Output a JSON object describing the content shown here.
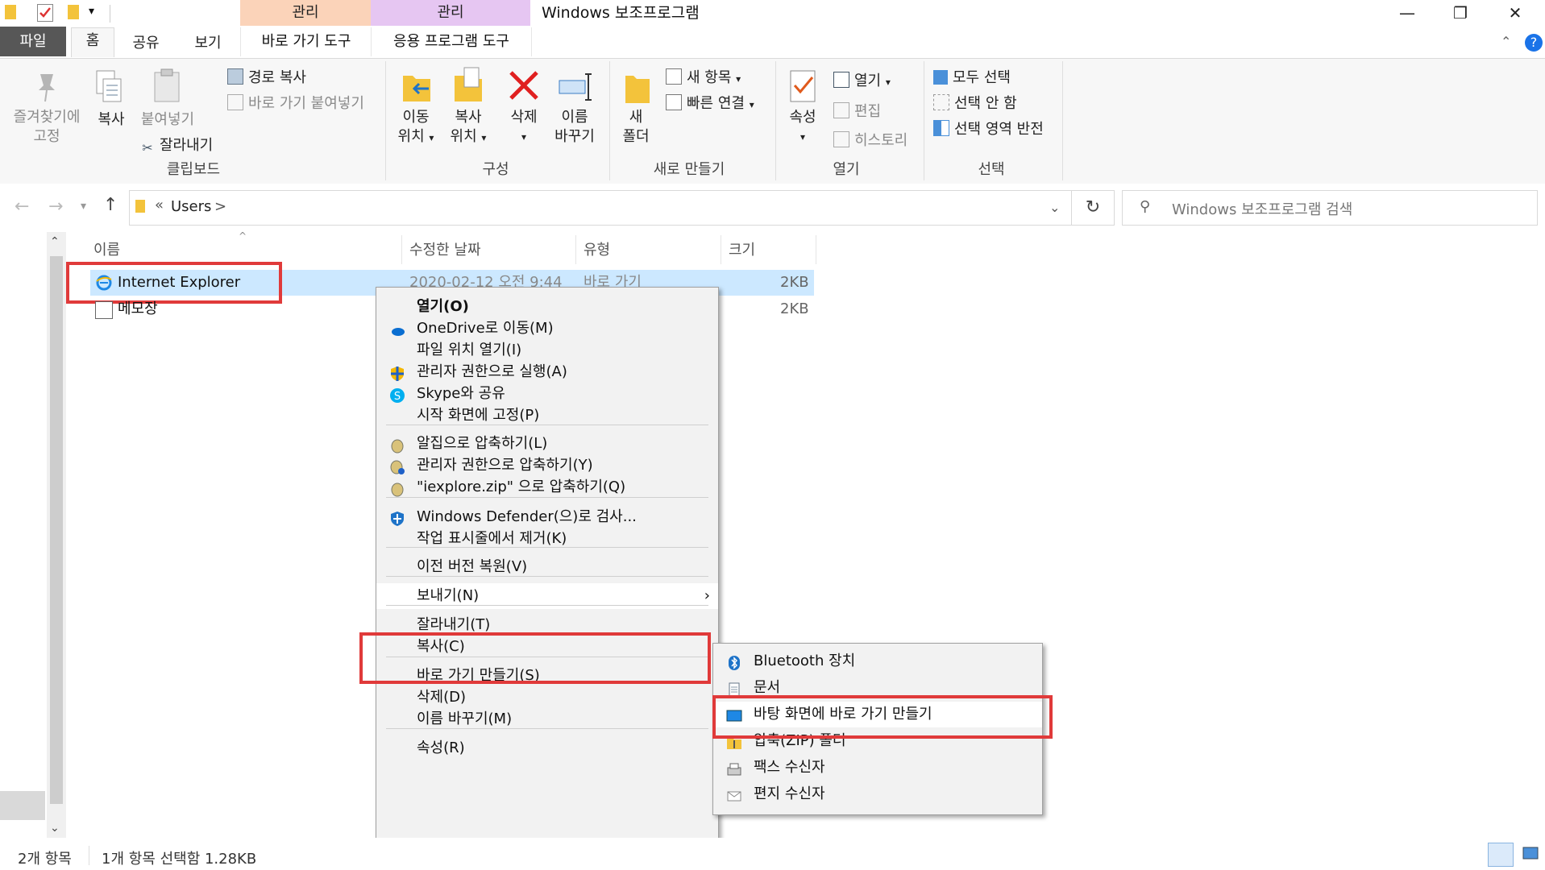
{
  "window": {
    "title": "Windows 보조프로그램",
    "context_header_1": "관리",
    "context_header_2": "관리",
    "minimize": "—",
    "maximize": "❐",
    "close": "✕"
  },
  "tabs": {
    "file": "파일",
    "home": "홈",
    "share": "공유",
    "view": "보기",
    "shortcut_tools": "바로 가기 도구",
    "app_tools": "응용 프로그램 도구"
  },
  "ribbon": {
    "pin_label_1": "즐겨찾기에",
    "pin_label_2": "고정",
    "copy": "복사",
    "paste": "붙여넣기",
    "copy_path": "경로 복사",
    "paste_shortcut": "바로 가기 붙여넣기",
    "cut": "잘라내기",
    "group_clipboard": "클립보드",
    "move_to_1": "이동",
    "move_to_2": "위치",
    "copy_to_1": "복사",
    "copy_to_2": "위치",
    "delete": "삭제",
    "rename_1": "이름",
    "rename_2": "바꾸기",
    "group_organize": "구성",
    "new_folder_1": "새",
    "new_folder_2": "폴더",
    "new_item": "새 항목",
    "easy_access": "빠른 연결",
    "group_new": "새로 만들기",
    "properties": "속성",
    "open": "열기",
    "edit": "편집",
    "history": "히스토리",
    "group_open": "열기",
    "select_all": "모두 선택",
    "select_none": "선택 안 함",
    "invert_selection": "선택 영역 반전",
    "group_select": "선택"
  },
  "address": {
    "path_prefix": "«",
    "path_users": "Users",
    "path_sep": ">",
    "search_placeholder": "Windows 보조프로그램 검색"
  },
  "columns": {
    "name": "이름",
    "date": "수정한 날짜",
    "type": "유형",
    "size": "크기"
  },
  "files": [
    {
      "name": "Internet Explorer",
      "date": "2020-02-12 오전 9:44",
      "type": "바로 가기",
      "size": "2KB"
    },
    {
      "name": "메모장",
      "size": "2KB"
    }
  ],
  "context_menu": [
    {
      "label": "열기(O)",
      "bold": true
    },
    {
      "label": "OneDrive로 이동(M)",
      "icon": "onedrive-icon"
    },
    {
      "label": "파일 위치 열기(I)"
    },
    {
      "label": "관리자 권한으로 실행(A)",
      "icon": "shield-icon"
    },
    {
      "label": "Skype와 공유",
      "icon": "skype-icon"
    },
    {
      "label": "시작 화면에 고정(P)"
    },
    {
      "label": "알집으로 압축하기(L)",
      "icon": "alzip-icon"
    },
    {
      "label": "관리자 권한으로 압축하기(Y)",
      "icon": "alzip-admin-icon"
    },
    {
      "label": "\"iexplore.zip\" 으로 압축하기(Q)",
      "icon": "alzip-icon"
    },
    {
      "label": "Windows Defender(으)로 검사...",
      "icon": "defender-icon"
    },
    {
      "label": "작업 표시줄에서 제거(K)"
    },
    {
      "label": "이전 버전 복원(V)"
    },
    {
      "label": "보내기(N)"
    },
    {
      "label": "잘라내기(T)"
    },
    {
      "label": "복사(C)"
    },
    {
      "label": "바로 가기 만들기(S)"
    },
    {
      "label": "삭제(D)"
    },
    {
      "label": "이름 바꾸기(M)"
    },
    {
      "label": "속성(R)"
    }
  ],
  "sendto_menu": [
    {
      "label": "Bluetooth 장치",
      "icon": "bluetooth-icon"
    },
    {
      "label": "문서",
      "icon": "documents-icon"
    },
    {
      "label": "바탕 화면에 바로 가기 만들기",
      "icon": "desktop-icon"
    },
    {
      "label": "압축(ZIP) 폴더",
      "icon": "zip-folder-icon"
    },
    {
      "label": "팩스 수신자",
      "icon": "fax-icon"
    },
    {
      "label": "편지 수신자",
      "icon": "mail-icon"
    }
  ],
  "status": {
    "item_count": "2개 항목",
    "selection": "1개 항목 선택함 1.28KB"
  },
  "colors": {
    "selection": "#cce8ff",
    "highlight_box": "#e03a3a",
    "file_tab": "#575757"
  }
}
